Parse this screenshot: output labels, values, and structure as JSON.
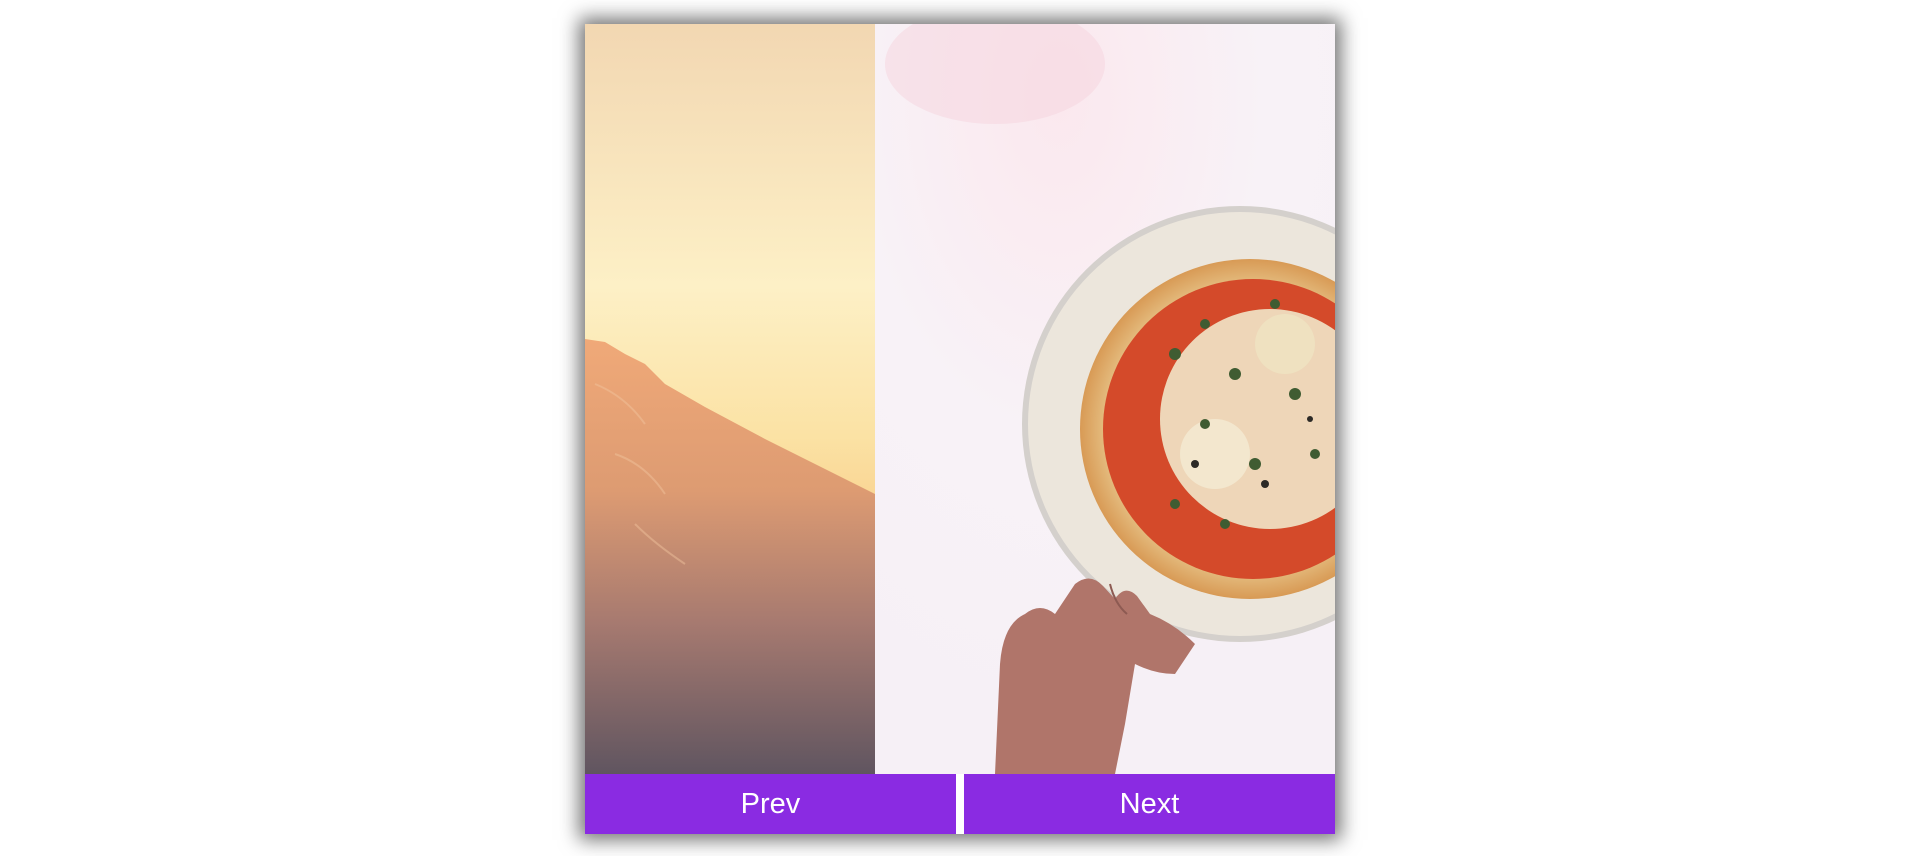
{
  "controls": {
    "prev_label": "Prev",
    "next_label": "Next"
  },
  "colors": {
    "button_bg": "#8a2be2",
    "button_text": "#ffffff"
  },
  "slides": [
    {
      "name": "sunset-mountain-photo"
    },
    {
      "name": "pizza-plate-photo"
    }
  ]
}
